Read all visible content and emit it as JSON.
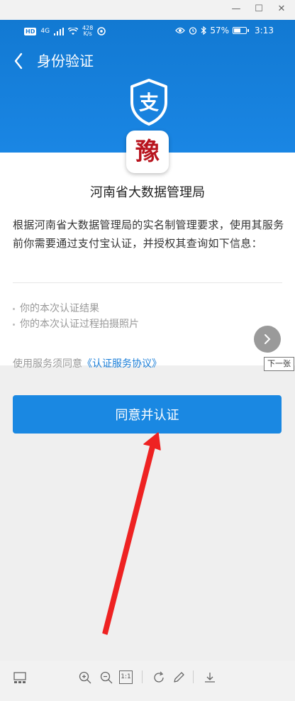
{
  "viewer": {
    "window_buttons": [
      "—",
      "☐",
      "✕"
    ],
    "next_tooltip": "下一张",
    "toolbar_icons": [
      "thumbnail-icon",
      "zoom-in-icon",
      "zoom-out-icon",
      "actual-size-icon",
      "rotate-icon",
      "edit-icon",
      "download-icon"
    ],
    "actual_size_label": "1:1"
  },
  "statusbar": {
    "hd_label": "HD",
    "network": "4G",
    "speed_value": "428",
    "speed_unit": "K/s",
    "battery_percent": "57%",
    "battery_level": 0.57,
    "time": "3:13"
  },
  "header": {
    "title": "身份验证",
    "logo_char": "支"
  },
  "content": {
    "org_logo_char": "豫",
    "org_name": "河南省大数据管理局",
    "intro": "根据河南省大数据管理局的实名制管理要求，使用其服务前你需要通过支付宝认证，并授权其查询如下信息：",
    "info_items": [
      "你的本次认证结果",
      "你的本次认证过程拍摄照片"
    ],
    "agreement_prefix": "使用服务须同意",
    "agreement_link": "《认证服务协议》",
    "confirm_button": "同意并认证"
  },
  "colors": {
    "primary": "#1a88e2",
    "header_top": "#1279d2",
    "seal_red": "#b8141e",
    "annotation_arrow": "#ee2222"
  }
}
